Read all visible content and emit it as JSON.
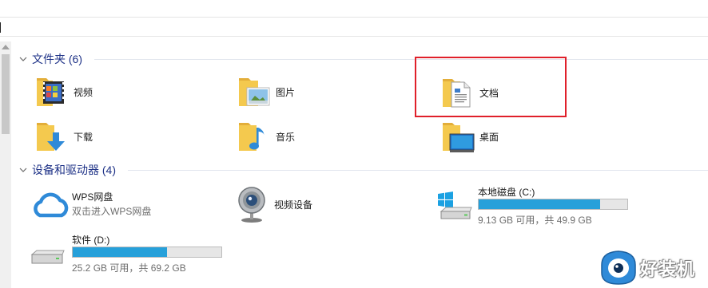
{
  "groups": {
    "folders": {
      "title": "文件夹 (6)"
    },
    "devices": {
      "title": "设备和驱动器 (4)"
    }
  },
  "folders": [
    {
      "label": "视频",
      "icon": "video-folder-icon"
    },
    {
      "label": "图片",
      "icon": "pictures-folder-icon"
    },
    {
      "label": "文档",
      "icon": "documents-folder-icon"
    },
    {
      "label": "下载",
      "icon": "downloads-folder-icon"
    },
    {
      "label": "音乐",
      "icon": "music-folder-icon"
    },
    {
      "label": "桌面",
      "icon": "desktop-folder-icon"
    }
  ],
  "devices": {
    "wps": {
      "name": "WPS网盘",
      "subtitle": "双击进入WPS网盘",
      "icon": "cloud-icon"
    },
    "camera": {
      "name": "视频设备",
      "icon": "webcam-icon"
    },
    "drive_c": {
      "name": "本地磁盘 (C:)",
      "info": "9.13 GB 可用，共 49.9 GB",
      "used_fraction": 0.817,
      "icon": "windows-drive-icon"
    },
    "drive_d": {
      "name": "软件 (D:)",
      "info": "25.2 GB 可用，共 69.2 GB",
      "used_fraction": 0.636,
      "icon": "hard-drive-icon"
    }
  },
  "watermark": {
    "text": "好装机"
  },
  "colors": {
    "group_title": "#1e3287",
    "bar_fill": "#26a0da",
    "highlight": "#e0202a",
    "folder": "#f4c94e"
  }
}
